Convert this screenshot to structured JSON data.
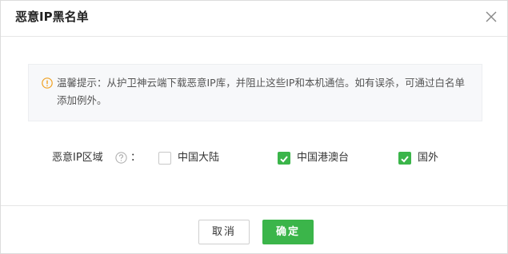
{
  "dialog": {
    "title": "恶意IP黑名单"
  },
  "notice": {
    "text": "温馨提示：从护卫神云端下载恶意IP库，并阻止这些IP和本机通信。如有误杀，可通过白名单添加例外。"
  },
  "region": {
    "label": "恶意IP区域",
    "colon": "：",
    "options": [
      {
        "label": "中国大陆",
        "checked": false
      },
      {
        "label": "中国港澳台",
        "checked": true
      },
      {
        "label": "国外",
        "checked": true
      }
    ]
  },
  "footer": {
    "cancel_label": "取消",
    "ok_label": "确定"
  },
  "colors": {
    "accent": "#3bb54a",
    "warning": "#f0a020"
  }
}
